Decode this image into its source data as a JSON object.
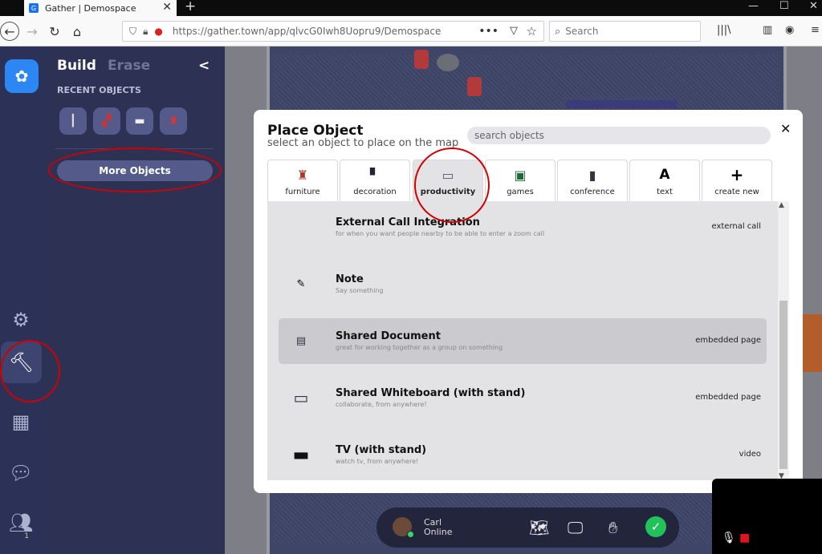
{
  "browser": {
    "tab_title": "Gather | Demospace",
    "url": "https://gather.town/app/qlvcG0Iwh8Uopru9/Demospace",
    "search_placeholder": "Search"
  },
  "build_panel": {
    "tab_build": "Build",
    "tab_erase": "Erase",
    "recent_heading": "RECENT OBJECTS",
    "more_objects_label": "More Objects"
  },
  "modal": {
    "title": "Place Object",
    "subtitle": "select an object to place on the map",
    "search_placeholder": "search objects",
    "close": "✕",
    "categories": [
      {
        "label": "furniture",
        "icon": "armchair-icon"
      },
      {
        "label": "decoration",
        "icon": "lamp-icon"
      },
      {
        "label": "productivity",
        "icon": "whiteboard-icon"
      },
      {
        "label": "games",
        "icon": "game-board-icon"
      },
      {
        "label": "conference",
        "icon": "kiosk-icon"
      },
      {
        "label": "text",
        "icon": "letter-a-icon"
      },
      {
        "label": "create new",
        "icon": "plus-icon"
      }
    ],
    "active_category": "productivity",
    "items": [
      {
        "name": "External Call Integration",
        "description": "for when you want people nearby to be able to enter a zoom call",
        "type": "external call",
        "icon": ""
      },
      {
        "name": "Note",
        "description": "Say something",
        "type": "",
        "icon": "note-icon"
      },
      {
        "name": "Shared Document",
        "description": "great for working together as a group on something",
        "type": "embedded page",
        "icon": "document-icon"
      },
      {
        "name": "Shared Whiteboard (with stand)",
        "description": "collaborate, from anywhere!",
        "type": "embedded page",
        "icon": "whiteboard-icon"
      },
      {
        "name": "TV (with stand)",
        "description": "watch tv, from anywhere!",
        "type": "video",
        "icon": "tv-icon"
      }
    ],
    "selected_item": "Shared Document"
  },
  "status": {
    "user_name": "Carl",
    "user_status": "Online"
  },
  "people_count": "1",
  "colors": {
    "sidebar": "#2c3257",
    "accent_blue": "#2d87f3",
    "annotation_red": "#d10000",
    "ok_green": "#21c25a"
  }
}
